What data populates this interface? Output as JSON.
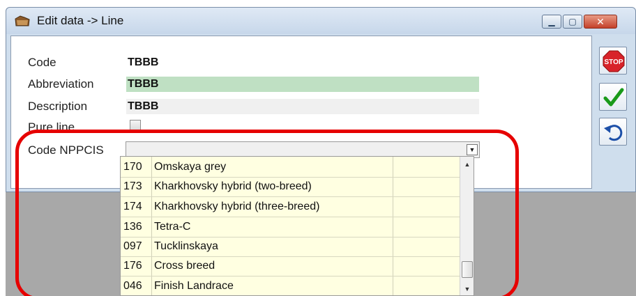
{
  "window": {
    "title": "Edit data -> Line",
    "icon": "folder-icon"
  },
  "form": {
    "code": {
      "label": "Code",
      "value": "TBBB"
    },
    "abbreviation": {
      "label": "Abbreviation",
      "value": "TBBB",
      "highlight_color": "#bfe0c3"
    },
    "description": {
      "label": "Description",
      "value": "TBBB"
    },
    "pure_line": {
      "label": "Pure line",
      "checked": false
    },
    "code_nppcis": {
      "label": "Code NPPCIS",
      "value": ""
    }
  },
  "side_buttons": {
    "stop": {
      "icon": "stop-icon",
      "color": "#d8232a"
    },
    "ok": {
      "icon": "checkmark-icon",
      "color": "#1a9a1a"
    },
    "undo": {
      "icon": "undo-icon",
      "color": "#1c4fa8"
    }
  },
  "dropdown": {
    "items": [
      {
        "code": "170",
        "name": "Omskaya grey"
      },
      {
        "code": "173",
        "name": "Kharkhovsky hybrid (two-breed)"
      },
      {
        "code": "174",
        "name": "Kharkhovsky hybrid (three-breed)"
      },
      {
        "code": "136",
        "name": "Tetra-C"
      },
      {
        "code": "097",
        "name": "Tucklinskaya"
      },
      {
        "code": "176",
        "name": "Cross breed"
      },
      {
        "code": "046",
        "name": "Finish Landrace"
      }
    ],
    "background": "#ffffe1"
  },
  "annotation": {
    "color": "#e60000"
  }
}
